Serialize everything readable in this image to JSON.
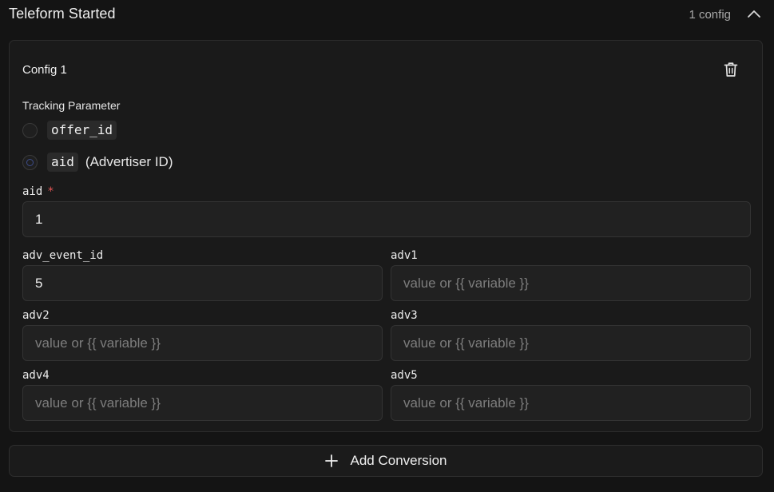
{
  "section": {
    "title": "Teleform Started",
    "config_count": "1 config"
  },
  "config": {
    "title": "Config 1",
    "tracking_label": "Tracking Parameter",
    "options": [
      {
        "code": "offer_id",
        "description": "",
        "selected": false
      },
      {
        "code": "aid",
        "description": "(Advertiser ID)",
        "selected": true
      }
    ],
    "fields": {
      "aid": {
        "label": "aid",
        "required_mark": "*",
        "value": "1"
      },
      "adv_event_id": {
        "label": "adv_event_id",
        "value": "5"
      },
      "adv1": {
        "label": "adv1",
        "placeholder": "value or {{ variable }}"
      },
      "adv2": {
        "label": "adv2",
        "placeholder": "value or {{ variable }}"
      },
      "adv3": {
        "label": "adv3",
        "placeholder": "value or {{ variable }}"
      },
      "adv4": {
        "label": "adv4",
        "placeholder": "value or {{ variable }}"
      },
      "adv5": {
        "label": "adv5",
        "placeholder": "value or {{ variable }}"
      }
    }
  },
  "actions": {
    "add_conversion": "Add Conversion"
  },
  "icons": {
    "collapse": "chevron-up-icon",
    "delete": "trash-icon",
    "add": "plus-icon"
  }
}
